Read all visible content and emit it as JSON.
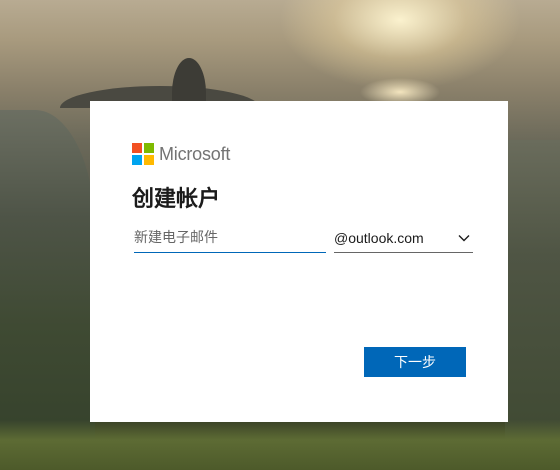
{
  "brand": {
    "name": "Microsoft",
    "colors": {
      "red": "#f25022",
      "green": "#7fba00",
      "blue": "#00a4ef",
      "yellow": "#ffb900"
    },
    "logo_icon": "microsoft-logo-icon"
  },
  "form": {
    "title": "创建帐户",
    "email_placeholder": "新建电子邮件",
    "email_value": "",
    "domain_selected": "@outlook.com",
    "domain_chevron_icon": "chevron-down-icon",
    "next_label": "下一步"
  },
  "colors": {
    "accent": "#0067b8",
    "card_background": "#ffffff",
    "title_text": "#1b1b1b"
  }
}
